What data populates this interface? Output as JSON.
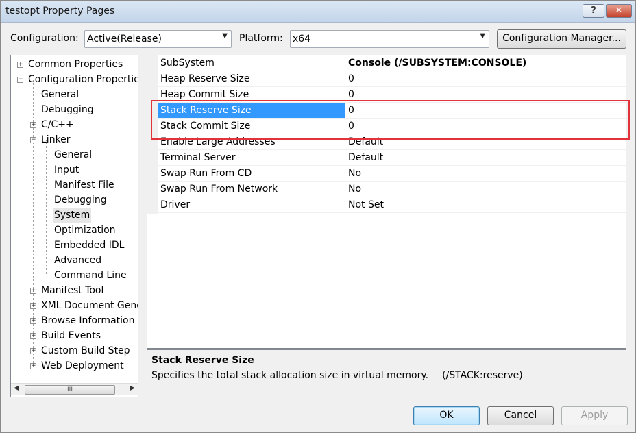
{
  "window": {
    "title": "testopt Property Pages",
    "help_glyph": "?",
    "close_glyph": "✕"
  },
  "config": {
    "configuration_label": "Configuration:",
    "configuration_value": "Active(Release)",
    "platform_label": "Platform:",
    "platform_value": "x64",
    "manager_button": "Configuration Manager..."
  },
  "tree": {
    "items": [
      {
        "label": "Common Properties",
        "expander": "+"
      },
      {
        "label": "Configuration Properties",
        "expander": "−"
      },
      {
        "label": "General"
      },
      {
        "label": "Debugging"
      },
      {
        "label": "C/C++",
        "expander": "+"
      },
      {
        "label": "Linker",
        "expander": "−"
      },
      {
        "label": "General"
      },
      {
        "label": "Input"
      },
      {
        "label": "Manifest File"
      },
      {
        "label": "Debugging"
      },
      {
        "label": "System",
        "selected": true
      },
      {
        "label": "Optimization"
      },
      {
        "label": "Embedded IDL"
      },
      {
        "label": "Advanced"
      },
      {
        "label": "Command Line"
      },
      {
        "label": "Manifest Tool",
        "expander": "+"
      },
      {
        "label": "XML Document Gene",
        "expander": "+"
      },
      {
        "label": "Browse Information",
        "expander": "+"
      },
      {
        "label": "Build Events",
        "expander": "+"
      },
      {
        "label": "Custom Build Step",
        "expander": "+"
      },
      {
        "label": "Web Deployment",
        "expander": "+"
      }
    ],
    "scroll_left": "◀",
    "scroll_right": "▶",
    "scroll_grip": "III"
  },
  "properties": [
    {
      "name": "SubSystem",
      "value": "Console (/SUBSYSTEM:CONSOLE)"
    },
    {
      "name": "Heap Reserve Size",
      "value": "0"
    },
    {
      "name": "Heap Commit Size",
      "value": "0"
    },
    {
      "name": "Stack Reserve Size",
      "value": "0"
    },
    {
      "name": "Stack Commit Size",
      "value": "0"
    },
    {
      "name": "Enable Large Addresses",
      "value": "Default"
    },
    {
      "name": "Terminal Server",
      "value": "Default"
    },
    {
      "name": "Swap Run From CD",
      "value": "No"
    },
    {
      "name": "Swap Run From Network",
      "value": "No"
    },
    {
      "name": "Driver",
      "value": "Not Set"
    }
  ],
  "description": {
    "title": "Stack Reserve Size",
    "text": "Specifies the total stack allocation size in virtual memory.",
    "flag": "(/STACK:reserve)"
  },
  "buttons": {
    "ok": "OK",
    "cancel": "Cancel",
    "apply": "Apply"
  },
  "colors": {
    "selection": "#3399ff",
    "highlight_box": "#e2323a"
  }
}
